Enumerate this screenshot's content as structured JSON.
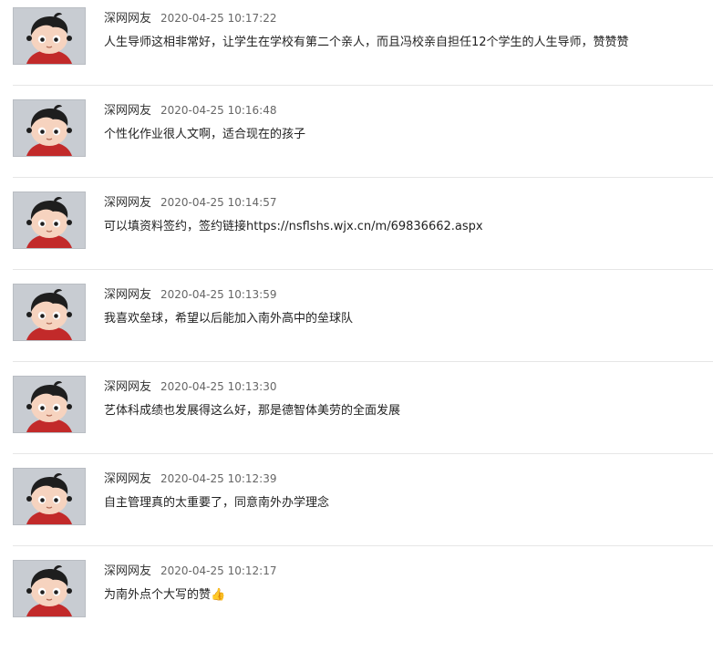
{
  "comments": [
    {
      "author": "深网网友",
      "time": "2020-04-25 10:17:22",
      "text": "人生导师这相非常好，让学生在学校有第二个亲人，而且冯校亲自担任12个学生的人生导师，赞赞赞"
    },
    {
      "author": "深网网友",
      "time": "2020-04-25 10:16:48",
      "text": "个性化作业很人文啊，适合现在的孩子"
    },
    {
      "author": "深网网友",
      "time": "2020-04-25 10:14:57",
      "text": "可以填资料签约，签约链接https://nsflshs.wjx.cn/m/69836662.aspx"
    },
    {
      "author": "深网网友",
      "time": "2020-04-25 10:13:59",
      "text": "我喜欢垒球，希望以后能加入南外高中的垒球队"
    },
    {
      "author": "深网网友",
      "time": "2020-04-25 10:13:30",
      "text": "艺体科成绩也发展得这么好，那是德智体美劳的全面发展"
    },
    {
      "author": "深网网友",
      "time": "2020-04-25 10:12:39",
      "text": "自主管理真的太重要了，同意南外办学理念"
    },
    {
      "author": "深网网友",
      "time": "2020-04-25 10:12:17",
      "text": "为南外点个大写的赞👍"
    }
  ]
}
